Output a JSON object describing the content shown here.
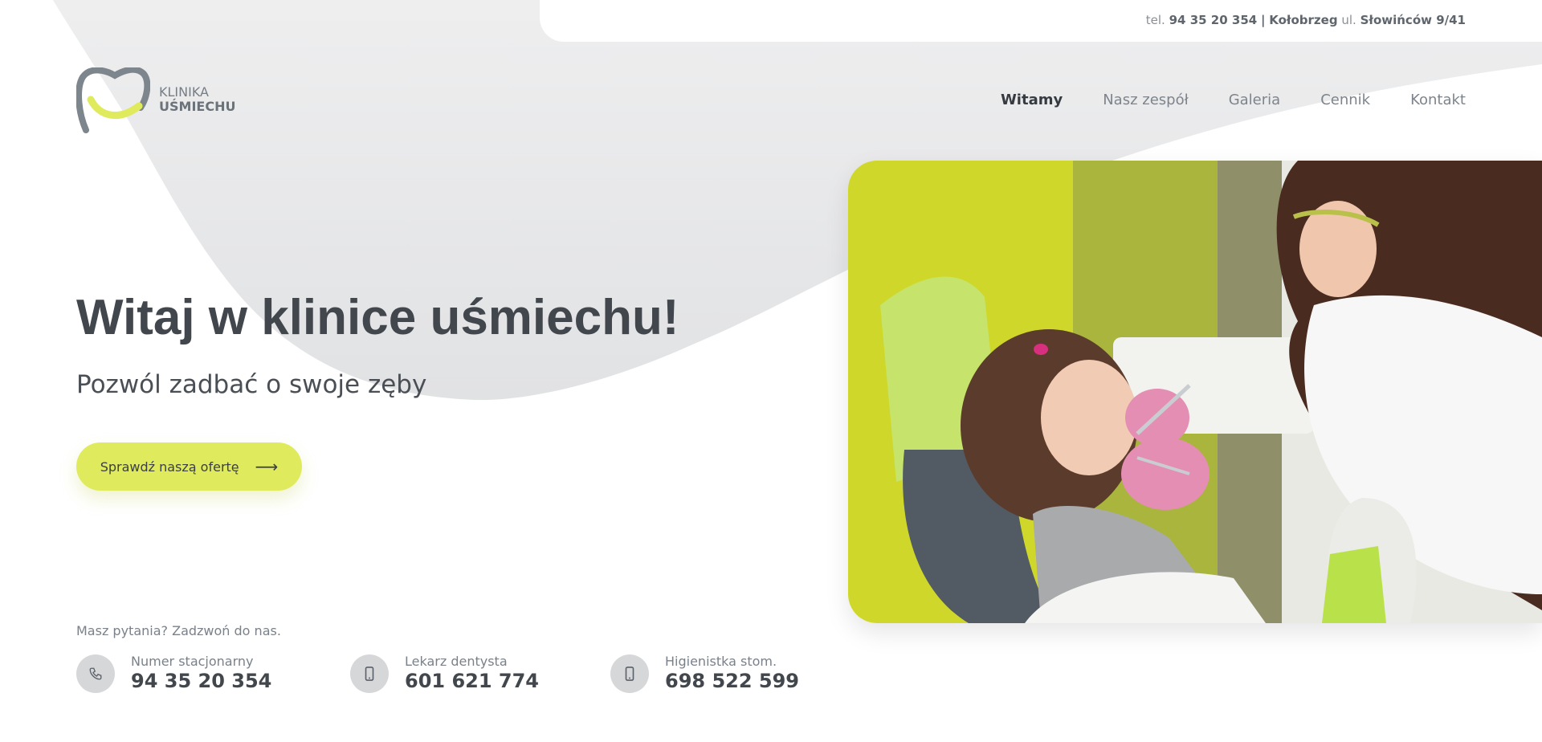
{
  "topbar": {
    "tel_prefix": "tel.",
    "phone": "94 35 20 354",
    "separator": "|",
    "city": "Kołobrzeg",
    "street_prefix": "ul.",
    "street": "Słowińców 9/41"
  },
  "logo": {
    "line1": "KLINIKA",
    "line2": "UŚMIECHU"
  },
  "nav": {
    "items": [
      {
        "label": "Witamy",
        "active": true
      },
      {
        "label": "Nasz zespół",
        "active": false
      },
      {
        "label": "Galeria",
        "active": false
      },
      {
        "label": "Cennik",
        "active": false
      },
      {
        "label": "Kontakt",
        "active": false
      }
    ]
  },
  "hero": {
    "title": "Witaj w klinice uśmiechu!",
    "subtitle": "Pozwól zadbać o swoje zęby",
    "cta_label": "Sprawdź naszą ofertę",
    "cta_icon": "arrow-right-icon"
  },
  "contact": {
    "question": "Masz pytania? Zadzwoń do nas.",
    "items": [
      {
        "label": "Numer stacjonarny",
        "number": "94 35 20 354",
        "icon": "phone-icon"
      },
      {
        "label": "Lekarz dentysta",
        "number": "601 621 774",
        "icon": "mobile-icon"
      },
      {
        "label": "Higienistka stom.",
        "number": "698 522 599",
        "icon": "mobile-icon"
      }
    ]
  },
  "colors": {
    "accent": "#dfeb5c",
    "text_dark": "#42474d",
    "blob_grey": "#e6e7e8",
    "photo_yellow": "#cfd82a"
  }
}
